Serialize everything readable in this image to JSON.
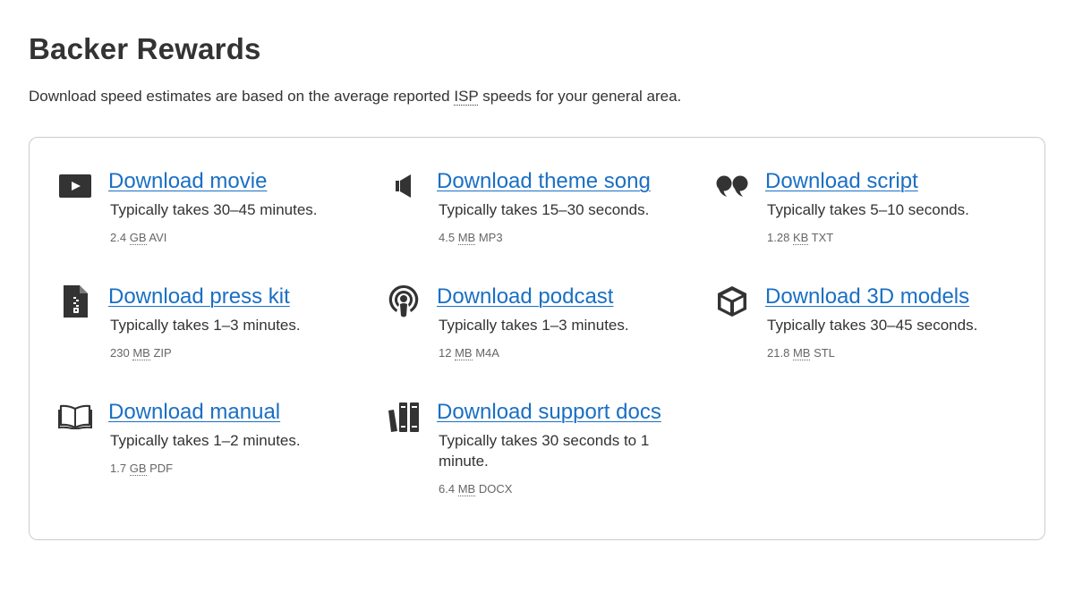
{
  "page": {
    "title": "Backer Rewards",
    "intro_before": "Download speed estimates are based on the average reported ",
    "intro_abbr": "ISP",
    "intro_after": " speeds for your general area."
  },
  "downloads": [
    {
      "icon": "play-icon",
      "label": "Download movie",
      "time": "Typically takes 30–45 minutes.",
      "size": "2.4",
      "unit": "GB",
      "format": "AVI"
    },
    {
      "icon": "speaker-icon",
      "label": "Download theme song",
      "time": "Typically takes 15–30 seconds.",
      "size": "4.5",
      "unit": "MB",
      "format": "MP3"
    },
    {
      "icon": "quote-icon",
      "label": "Download script",
      "time": "Typically takes 5–10 seconds.",
      "size": "1.28",
      "unit": "KB",
      "format": "TXT"
    },
    {
      "icon": "zip-file-icon",
      "label": "Download press kit",
      "time": "Typically takes 1–3 minutes.",
      "size": "230",
      "unit": "MB",
      "format": "ZIP"
    },
    {
      "icon": "podcast-icon",
      "label": "Download podcast",
      "time": "Typically takes 1–3 minutes.",
      "size": "12",
      "unit": "MB",
      "format": "M4A"
    },
    {
      "icon": "cube-icon",
      "label": "Download 3D models",
      "time": "Typically takes 30–45 seconds.",
      "size": "21.8",
      "unit": "MB",
      "format": "STL"
    },
    {
      "icon": "book-open-icon",
      "label": "Download manual",
      "time": "Typically takes 1–2 minutes.",
      "size": "1.7",
      "unit": "GB",
      "format": "PDF"
    },
    {
      "icon": "books-icon",
      "label": "Download support docs",
      "time": "Typically takes 30 seconds to 1 minute.",
      "size": "6.4",
      "unit": "MB",
      "format": "DOCX"
    }
  ],
  "colors": {
    "link": "#1a6fc4",
    "text": "#333333",
    "muted": "#666666",
    "border": "#cccccc"
  }
}
